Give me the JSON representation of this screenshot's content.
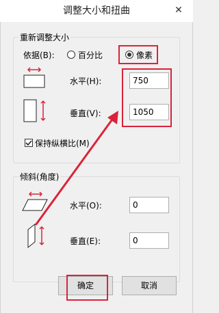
{
  "window": {
    "title": "调整大小和扭曲",
    "close_icon": "close-icon"
  },
  "resize": {
    "legend": "重新调整大小",
    "by_label": "依据(B):",
    "percent_label": "百分比",
    "pixels_label": "像素",
    "selected": "pixels",
    "horizontal_label": "水平(H):",
    "horizontal_value": "750",
    "vertical_label": "垂直(V):",
    "vertical_value": "1050",
    "keep_ratio_label": "保持纵横比(M)",
    "keep_ratio_checked": true
  },
  "skew": {
    "legend": "倾斜(角度)",
    "horizontal_label": "水平(O):",
    "horizontal_value": "0",
    "vertical_label": "垂直(E):",
    "vertical_value": "0"
  },
  "buttons": {
    "ok": "确定",
    "cancel": "取消"
  },
  "colors": {
    "highlight": "#d9233a"
  }
}
